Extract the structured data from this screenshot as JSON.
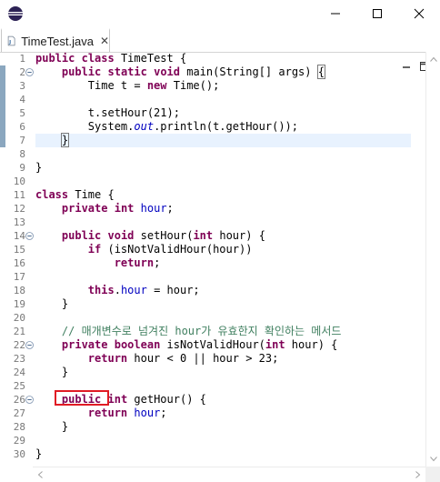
{
  "window": {
    "app_icon": "eclipse-icon",
    "minimize_icon": "minimize-icon",
    "maximize_icon": "maximize-icon",
    "close_icon": "close-icon"
  },
  "tab": {
    "label": "TimeTest.java",
    "icon": "java-file-icon",
    "close_glyph": "✕"
  },
  "editor": {
    "lines": [
      {
        "n": "1",
        "fold": false,
        "html": "<span class=\"kw\">public</span> <span class=\"kw\">class</span> TimeTest {"
      },
      {
        "n": "2",
        "fold": true,
        "html": "    <span class=\"kw\">public</span> <span class=\"kw\">static</span> <span class=\"kw\">void</span> main(String[] args) <span class=\"br-box\">{</span>"
      },
      {
        "n": "3",
        "fold": false,
        "html": "        Time t = <span class=\"kw\">new</span> Time();"
      },
      {
        "n": "4",
        "fold": false,
        "html": ""
      },
      {
        "n": "5",
        "fold": false,
        "html": "        t.setHour(21);"
      },
      {
        "n": "6",
        "fold": false,
        "html": "        System.<span class=\"st\">out</span>.println(t.getHour());"
      },
      {
        "n": "7",
        "fold": false,
        "current": true,
        "html": "    <span class=\"br-box\">}</span>"
      },
      {
        "n": "8",
        "fold": false,
        "html": ""
      },
      {
        "n": "9",
        "fold": false,
        "html": "}"
      },
      {
        "n": "10",
        "fold": false,
        "html": ""
      },
      {
        "n": "11",
        "fold": false,
        "html": "<span class=\"kw\">class</span> Time {"
      },
      {
        "n": "12",
        "fold": false,
        "html": "    <span class=\"kw\">private</span> <span class=\"kw\">int</span> <span class=\"fld\">hour</span>;"
      },
      {
        "n": "13",
        "fold": false,
        "html": ""
      },
      {
        "n": "14",
        "fold": true,
        "html": "    <span class=\"kw\">public</span> <span class=\"kw\">void</span> setHour(<span class=\"kw\">int</span> hour) {"
      },
      {
        "n": "15",
        "fold": false,
        "html": "        <span class=\"kw\">if</span> (isNotValidHour(hour))"
      },
      {
        "n": "16",
        "fold": false,
        "html": "            <span class=\"kw\">return</span>;"
      },
      {
        "n": "17",
        "fold": false,
        "html": ""
      },
      {
        "n": "18",
        "fold": false,
        "html": "        <span class=\"kw\">this</span>.<span class=\"fld\">hour</span> = hour;"
      },
      {
        "n": "19",
        "fold": false,
        "html": "    }"
      },
      {
        "n": "20",
        "fold": false,
        "html": ""
      },
      {
        "n": "21",
        "fold": false,
        "html": "    <span class=\"cm\">// 매개변수로 넘겨진 hour가 유효한지 확인하는 메서드</span>"
      },
      {
        "n": "22",
        "fold": true,
        "html": "    <span class=\"kw\">private</span> <span class=\"kw\">boolean</span> isNotValidHour(<span class=\"kw\">int</span> hour) {"
      },
      {
        "n": "23",
        "fold": false,
        "html": "        <span class=\"kw\">return</span> hour &lt; 0 || hour &gt; 23;"
      },
      {
        "n": "24",
        "fold": false,
        "html": "    }"
      },
      {
        "n": "25",
        "fold": false,
        "html": ""
      },
      {
        "n": "26",
        "fold": true,
        "html": "    <span class=\"kw\">public</span> <span class=\"kw\">int</span> getHour() {"
      },
      {
        "n": "27",
        "fold": false,
        "html": "        <span class=\"kw\">return</span> <span class=\"fld\">hour</span>;"
      },
      {
        "n": "28",
        "fold": false,
        "html": "    }"
      },
      {
        "n": "29",
        "fold": false,
        "html": ""
      },
      {
        "n": "30",
        "fold": false,
        "html": "}"
      }
    ]
  },
  "colors": {
    "keyword": "#7f0055",
    "field": "#0000c0",
    "comment": "#3f7f5f",
    "current_line": "#e8f2fe",
    "highlight_box": "#e01b24",
    "change_marker": "#8ba7bf"
  }
}
